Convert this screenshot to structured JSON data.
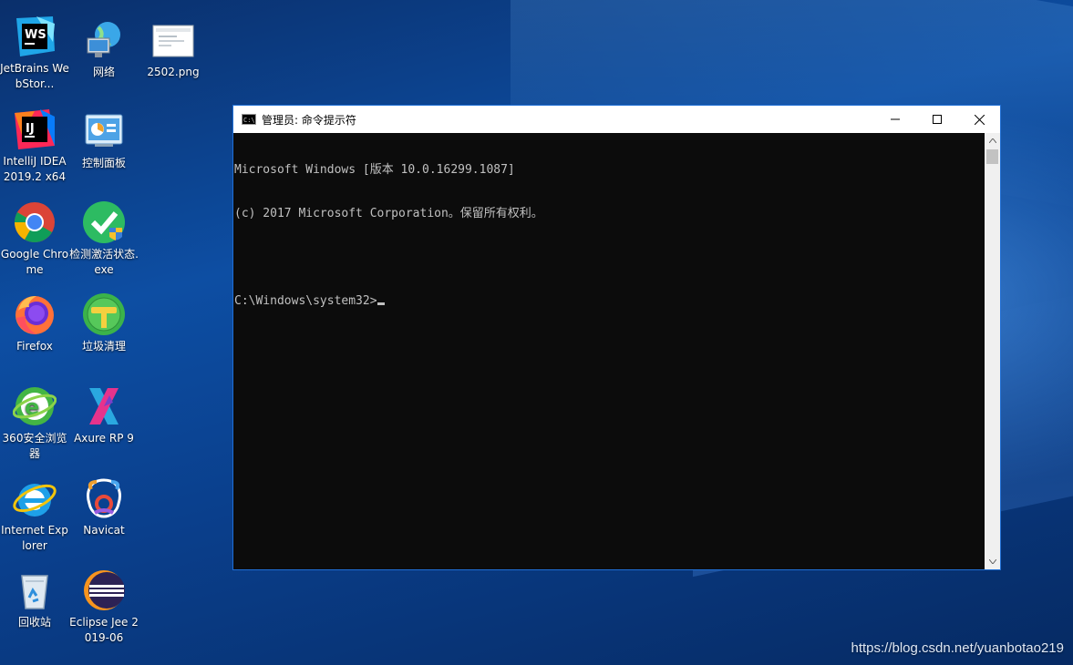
{
  "desktop": {
    "icons": [
      {
        "label": "JetBrains WebStor...",
        "icon": "webstorm-icon"
      },
      {
        "label": "网络",
        "icon": "network-icon"
      },
      {
        "label": "2502.png",
        "icon": "image-file-icon"
      },
      {
        "label": "IntelliJ IDEA 2019.2 x64",
        "icon": "intellij-icon"
      },
      {
        "label": "控制面板",
        "icon": "control-panel-icon"
      },
      {
        "label": "Google Chrome",
        "icon": "chrome-icon"
      },
      {
        "label": "检测激活状态.exe",
        "icon": "shield-check-icon"
      },
      {
        "label": "Firefox",
        "icon": "firefox-icon"
      },
      {
        "label": "垃圾清理",
        "icon": "cleaner-icon"
      },
      {
        "label": "360安全浏览器",
        "icon": "360-browser-icon"
      },
      {
        "label": "Axure RP 9",
        "icon": "axure-icon"
      },
      {
        "label": "Internet Explorer",
        "icon": "ie-icon"
      },
      {
        "label": "Navicat",
        "icon": "navicat-icon"
      },
      {
        "label": "回收站",
        "icon": "recycle-bin-icon"
      },
      {
        "label": "Eclipse Jee 2019-06",
        "icon": "eclipse-icon"
      }
    ]
  },
  "cmd_window": {
    "title": "管理员: 命令提示符",
    "icon_text": "C:\\",
    "lines": [
      "Microsoft Windows [版本 10.0.16299.1087]",
      "(c) 2017 Microsoft Corporation。保留所有权利。",
      "",
      "C:\\Windows\\system32>"
    ]
  },
  "watermark": "https://blog.csdn.net/yuanbotao219",
  "colors": {
    "console_bg": "#0c0c0c",
    "console_text": "#c0c0c0",
    "window_border": "#1f6fd6"
  }
}
